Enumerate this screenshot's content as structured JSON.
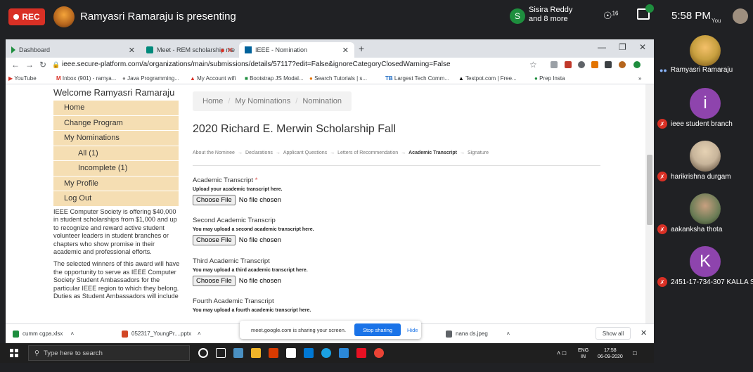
{
  "meet": {
    "rec_label": "REC",
    "presenter_text": "Ramyasri Ramaraju is presenting",
    "participants_header": {
      "avatar_letter": "S",
      "line1": "Sisira Reddy",
      "line2": "and 8 more"
    },
    "participant_count": "16",
    "clock": "5:58 PM",
    "you_label": "You",
    "share_banner": {
      "text": "meet.google.com is sharing your screen.",
      "stop_label": "Stop sharing",
      "hide_label": "Hide"
    },
    "participants": [
      {
        "name": "Ramyasri Ramaraju",
        "avatar_letter": "",
        "color": "#c8a040",
        "muted": false
      },
      {
        "name": "ieee student branch",
        "avatar_letter": "i",
        "color": "#8e44ad",
        "muted": true
      },
      {
        "name": "harikrishna durgam",
        "avatar_letter": "",
        "color": "#c7b49a",
        "muted": true
      },
      {
        "name": "aakanksha thota",
        "avatar_letter": "",
        "color": "#6b7c56",
        "muted": true
      },
      {
        "name": "2451-17-734-307 KALLA S",
        "avatar_letter": "K",
        "color": "#8e44ad",
        "muted": true
      }
    ]
  },
  "browser": {
    "tabs": [
      {
        "label": "Dashboard"
      },
      {
        "label": "Meet - REM scholarship me"
      },
      {
        "label": "IEEE - Nomination"
      }
    ],
    "url": "ieee.secure-platform.com/a/organizations/main/submissions/details/57117?edit=False&ignoreCategoryClosedWarning=False",
    "bookmarks": [
      "YouTube",
      "Inbox (901) - ramya...",
      "Java Programming...",
      "My Account wifi",
      "Bootstrap JS Modal...",
      "Search Tutorials | s...",
      "Largest Tech Comm...",
      "Testpot.com | Free...",
      "Prep Insta"
    ],
    "downloads": [
      "cumm cgpa.xlsx",
      "052317_YoungPr....pptx",
      "nana ds.jpeg"
    ],
    "show_all_label": "Show all"
  },
  "page": {
    "welcome": "Welcome Ramyasri Ramaraju",
    "nav": [
      {
        "label": "Home",
        "sub": false
      },
      {
        "label": "Change Program",
        "sub": false
      },
      {
        "label": "My Nominations",
        "sub": false
      },
      {
        "label": "All (1)",
        "sub": true
      },
      {
        "label": "Incomplete (1)",
        "sub": true
      },
      {
        "label": "My Profile",
        "sub": false
      },
      {
        "label": "Log Out",
        "sub": false
      }
    ],
    "sidebar_paragraphs": [
      "IEEE Computer Society is offering $40,000 in student scholarships from $1,000 and up to recognize and reward active student volunteer leaders in student branches or chapters who show promise in their academic and professional efforts.",
      "The selected winners of this award will have the opportunity to serve as IEEE Computer Society Student Ambassadors for the particular IEEE region to which they belong. Duties as Student Ambassadors will include"
    ],
    "breadcrumb": [
      "Home",
      "My Nominations",
      "Nomination"
    ],
    "title": "2020 Richard E. Merwin Scholarship Fall",
    "steps": [
      {
        "label": "About the Nominee",
        "current": false
      },
      {
        "label": "Declarations",
        "current": false
      },
      {
        "label": "Applicant Questions",
        "current": false
      },
      {
        "label": "Letters of Recommendation",
        "current": false
      },
      {
        "label": "Academic Transcript",
        "current": true
      },
      {
        "label": "Signature",
        "current": false
      }
    ],
    "fields": [
      {
        "label": "Academic Transcript",
        "required": true,
        "help": "Upload your academic transcript here."
      },
      {
        "label": "Second Academic Transcrip",
        "required": false,
        "help": "You may upload a second academic transcript here."
      },
      {
        "label": "Third Academic Transcript",
        "required": false,
        "help": "You may upload a third academic transcript here."
      },
      {
        "label": "Fourth Academic Transcript",
        "required": false,
        "help": "You may upload a fourth academic transcript here."
      }
    ],
    "choose_file_label": "Choose File",
    "no_file_label": "No file chosen"
  },
  "taskbar": {
    "search_placeholder": "Type here to search",
    "lang": "ENG",
    "region": "IN",
    "time": "17:58",
    "date": "06-09-2020"
  }
}
